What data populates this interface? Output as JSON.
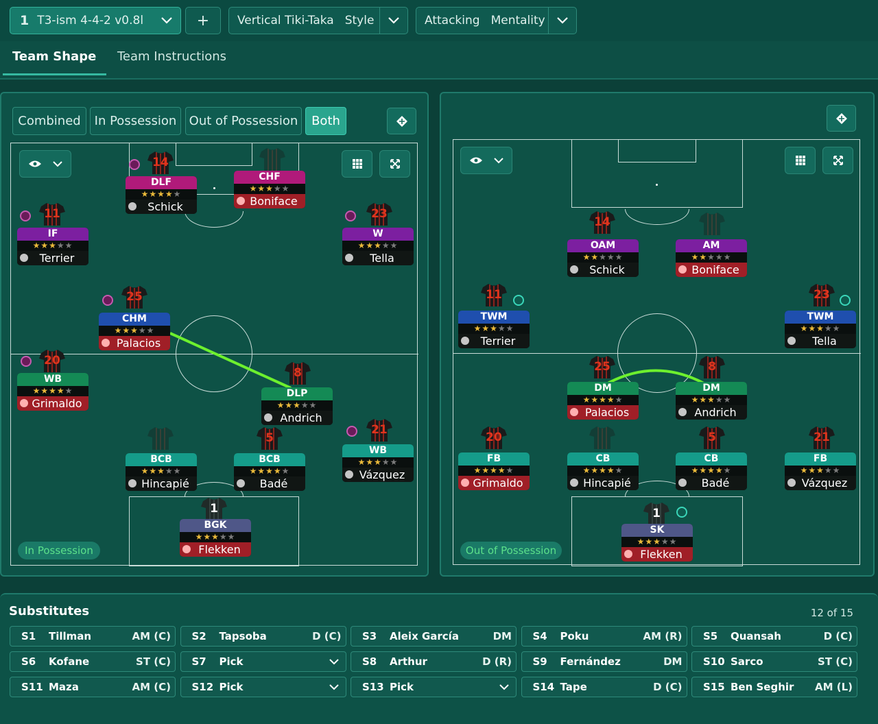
{
  "topbar": {
    "tactic_number": "1",
    "tactic_name": "T3-ism 4-4-2 v0.8l",
    "add_label": "+",
    "style_value": "Vertical Tiki-Taka",
    "style_key": "Style",
    "mentality_value": "Attacking",
    "mentality_key": "Mentality"
  },
  "tabs": [
    "Team Shape",
    "Team Instructions"
  ],
  "modes": [
    "Combined",
    "In Possession",
    "Out of Possession",
    "Both"
  ],
  "selected_mode": "Both",
  "left_pitch": {
    "label": "In Possession",
    "players": [
      {
        "role": "DLF",
        "stars": 4,
        "half": 0,
        "name": "Schick",
        "number": "14",
        "color": "magenta",
        "injured": false,
        "badge": "purple"
      },
      {
        "role": "CHF",
        "stars": 2,
        "half": 1,
        "name": "Boniface",
        "number": "",
        "color": "magenta",
        "injured": true,
        "badge": ""
      },
      {
        "role": "IF",
        "stars": 3,
        "half": 0,
        "name": "Terrier",
        "number": "11",
        "color": "purple",
        "injured": false,
        "badge": "purple"
      },
      {
        "role": "W",
        "stars": 2,
        "half": 1,
        "name": "Tella",
        "number": "23",
        "color": "purple",
        "injured": false,
        "badge": "purple"
      },
      {
        "role": "CHM",
        "stars": 2,
        "half": 1,
        "name": "Palacios",
        "number": "25",
        "color": "blue",
        "injured": true,
        "badge": "purple"
      },
      {
        "role": "WB",
        "stars": 3,
        "half": 1,
        "name": "Grimaldo",
        "number": "20",
        "color": "green",
        "injured": true,
        "badge": "purple"
      },
      {
        "role": "DLP",
        "stars": 2,
        "half": 1,
        "name": "Andrich",
        "number": "8",
        "color": "green",
        "injured": false,
        "badge": ""
      },
      {
        "role": "BCB",
        "stars": 3,
        "half": 0,
        "name": "Hincapié",
        "number": "",
        "color": "teal",
        "injured": false,
        "badge": ""
      },
      {
        "role": "BCB",
        "stars": 4,
        "half": 0,
        "name": "Badé",
        "number": "5",
        "color": "teal",
        "injured": false,
        "badge": ""
      },
      {
        "role": "WB",
        "stars": 2,
        "half": 1,
        "name": "Vázquez",
        "number": "21",
        "color": "teal",
        "injured": false,
        "badge": "purple"
      },
      {
        "role": "BGK",
        "stars": 3,
        "half": 0,
        "name": "Flekken",
        "number": "1",
        "color": "grey",
        "injured": true,
        "badge": ""
      }
    ]
  },
  "right_pitch": {
    "label": "Out of Possession",
    "players": [
      {
        "role": "OAM",
        "stars": 1,
        "half": 1,
        "name": "Schick",
        "number": "14",
        "color": "purple",
        "injured": false,
        "badge": ""
      },
      {
        "role": "AM",
        "stars": 2,
        "half": 0,
        "name": "Boniface",
        "number": "",
        "color": "purple",
        "injured": true,
        "badge": ""
      },
      {
        "role": "TWM",
        "stars": 2,
        "half": 1,
        "name": "Terrier",
        "number": "11",
        "color": "blue",
        "injured": false,
        "badge": "teal"
      },
      {
        "role": "TWM",
        "stars": 2,
        "half": 1,
        "name": "Tella",
        "number": "23",
        "color": "blue",
        "injured": false,
        "badge": "teal"
      },
      {
        "role": "DM",
        "stars": 3,
        "half": 1,
        "name": "Palacios",
        "number": "25",
        "color": "green",
        "injured": true,
        "badge": ""
      },
      {
        "role": "DM",
        "stars": 3,
        "half": 0,
        "name": "Andrich",
        "number": "8",
        "color": "green",
        "injured": false,
        "badge": ""
      },
      {
        "role": "FB",
        "stars": 3,
        "half": 1,
        "name": "Grimaldo",
        "number": "20",
        "color": "teal",
        "injured": true,
        "badge": ""
      },
      {
        "role": "CB",
        "stars": 3,
        "half": 1,
        "name": "Hincapié",
        "number": "",
        "color": "teal",
        "injured": false,
        "badge": ""
      },
      {
        "role": "CB",
        "stars": 4,
        "half": 0,
        "name": "Badé",
        "number": "5",
        "color": "teal",
        "injured": false,
        "badge": ""
      },
      {
        "role": "FB",
        "stars": 2,
        "half": 1,
        "name": "Vázquez",
        "number": "21",
        "color": "teal",
        "injured": false,
        "badge": ""
      },
      {
        "role": "SK",
        "stars": 3,
        "half": 0,
        "name": "Flekken",
        "number": "1",
        "color": "grey",
        "injured": true,
        "badge": "teal"
      }
    ]
  },
  "substitutes": {
    "title": "Substitutes",
    "count": "12 of 15",
    "slots": [
      {
        "slot": "S1",
        "name": "Tillman",
        "pos": "AM (C)",
        "dropdown": false
      },
      {
        "slot": "S2",
        "name": "Tapsoba",
        "pos": "D (C)",
        "dropdown": false
      },
      {
        "slot": "S3",
        "name": "Aleix García",
        "pos": "DM",
        "dropdown": false
      },
      {
        "slot": "S4",
        "name": "Poku",
        "pos": "AM (R)",
        "dropdown": false
      },
      {
        "slot": "S5",
        "name": "Quansah",
        "pos": "D (C)",
        "dropdown": false
      },
      {
        "slot": "S6",
        "name": "Kofane",
        "pos": "ST (C)",
        "dropdown": false
      },
      {
        "slot": "S7",
        "name": "Pick",
        "pos": "",
        "dropdown": true
      },
      {
        "slot": "S8",
        "name": "Arthur",
        "pos": "D (R)",
        "dropdown": false
      },
      {
        "slot": "S9",
        "name": "Fernández",
        "pos": "DM",
        "dropdown": false
      },
      {
        "slot": "S10",
        "name": "Sarco",
        "pos": "ST (C)",
        "dropdown": false
      },
      {
        "slot": "S11",
        "name": "Maza",
        "pos": "AM (C)",
        "dropdown": false
      },
      {
        "slot": "S12",
        "name": "Pick",
        "pos": "",
        "dropdown": true
      },
      {
        "slot": "S13",
        "name": "Pick",
        "pos": "",
        "dropdown": true
      },
      {
        "slot": "S14",
        "name": "Tape",
        "pos": "D (C)",
        "dropdown": false
      },
      {
        "slot": "S15",
        "name": "Ben Seghir",
        "pos": "AM (L)",
        "dropdown": false
      }
    ]
  },
  "icons": {
    "eye": "eye-icon",
    "grid": "grid-icon",
    "expand": "expand-icon",
    "pitch_view": "pitch-view-icon",
    "chevron": "chevron-down-icon",
    "person": "person-icon"
  }
}
